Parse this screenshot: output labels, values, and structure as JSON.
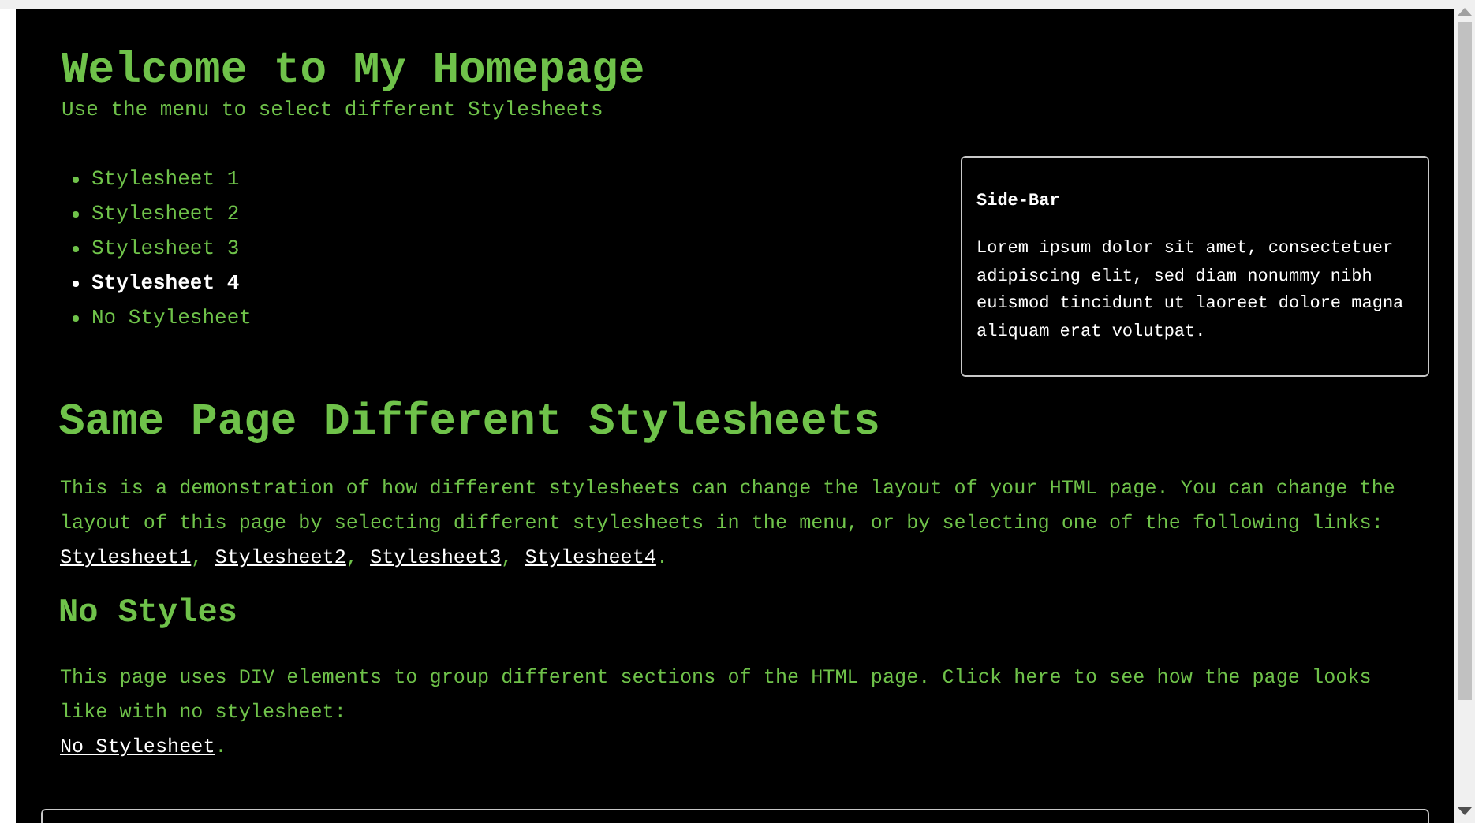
{
  "header": {
    "title": "Welcome to My Homepage",
    "subtitle": "Use the menu to select different Stylesheets"
  },
  "menu": [
    {
      "label": "Stylesheet 1",
      "selected": false
    },
    {
      "label": "Stylesheet 2",
      "selected": false
    },
    {
      "label": "Stylesheet 3",
      "selected": false
    },
    {
      "label": "Stylesheet 4",
      "selected": true
    },
    {
      "label": "No Stylesheet",
      "selected": false
    }
  ],
  "sidebar": {
    "title": "Side-Bar",
    "text": "Lorem ipsum dolor sit amet, consectetuer adipiscing elit, sed diam nonummy nibh euismod tincidunt ut laoreet dolore magna aliquam erat volutpat."
  },
  "sections": [
    {
      "heading": "Same Page Different Stylesheets",
      "kind": "major",
      "parts": [
        {
          "kind": "text",
          "text": "This is a demonstration of how different stylesheets can change the layout of your HTML page. You can change the layout of this page by selecting different stylesheets in the menu, or by selecting one of the following links: "
        },
        {
          "kind": "link",
          "text": "Stylesheet1"
        },
        {
          "kind": "text",
          "text": ", "
        },
        {
          "kind": "link",
          "text": "Stylesheet2"
        },
        {
          "kind": "text",
          "text": ", "
        },
        {
          "kind": "link",
          "text": "Stylesheet3"
        },
        {
          "kind": "text",
          "text": ", "
        },
        {
          "kind": "link",
          "text": "Stylesheet4"
        },
        {
          "kind": "text",
          "text": "."
        }
      ]
    },
    {
      "heading": "No Styles",
      "kind": "minor",
      "parts": [
        {
          "kind": "text",
          "text": "This page uses DIV elements to group different sections of the HTML page. Click here to see how the page looks like with no stylesheet:"
        },
        {
          "kind": "break"
        },
        {
          "kind": "link",
          "text": "No Stylesheet"
        },
        {
          "kind": "text",
          "text": "."
        }
      ]
    }
  ]
}
